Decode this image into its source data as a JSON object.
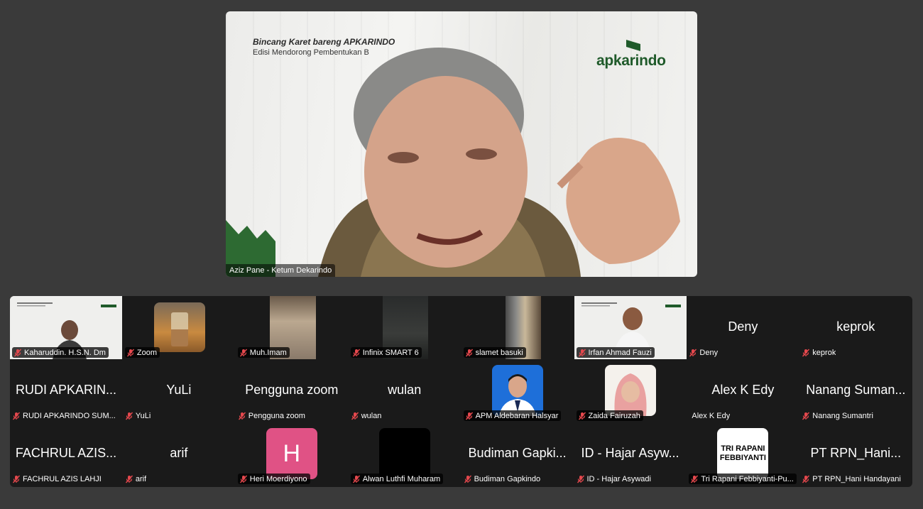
{
  "speaker": {
    "name": "Aziz Pane - Ketum Dekarindo",
    "banner_title": "Bincang Karet bareng APKARINDO",
    "banner_subtitle": "Edisi Mendorong Pembentukan B",
    "logo": "apkarindo"
  },
  "participants": [
    {
      "name": "Kaharuddin. H.S.N. Dm",
      "display": "",
      "video": "banner"
    },
    {
      "name": "Zoom",
      "display": "",
      "video": "drink"
    },
    {
      "name": "Muh.Imam",
      "display": "",
      "video": "wall"
    },
    {
      "name": "Infinix SMART 6",
      "display": "",
      "video": "dark"
    },
    {
      "name": "slamet basuki",
      "display": "",
      "video": "door"
    },
    {
      "name": "Irfan Ahmad Fauzi",
      "display": "",
      "video": "banner2"
    },
    {
      "name": "Deny",
      "display": "Deny",
      "video": "none"
    },
    {
      "name": "keprok",
      "display": "keprok",
      "video": "none"
    },
    {
      "name": "RUDI APKARINDO SUM...",
      "display": "RUDI APKARIN...",
      "video": "none"
    },
    {
      "name": "YuLi",
      "display": "YuLi",
      "video": "none"
    },
    {
      "name": "Pengguna zoom",
      "display": "Pengguna zoom",
      "video": "none"
    },
    {
      "name": "wulan",
      "display": "wulan",
      "video": "none"
    },
    {
      "name": "APM Aldebaran Halsyar",
      "display": "",
      "video": "avatar-man"
    },
    {
      "name": "Zaida Fairuzah",
      "display": "",
      "video": "avatar-woman"
    },
    {
      "name": "Alex K Edy",
      "display": "Alex K Edy",
      "video": "none",
      "unmuted": true
    },
    {
      "name": "Nanang Sumantri",
      "display": "Nanang Suman...",
      "video": "none"
    },
    {
      "name": "FACHRUL AZIS LAHJI",
      "display": "FACHRUL AZIS...",
      "video": "none"
    },
    {
      "name": "arif",
      "display": "arif",
      "video": "none"
    },
    {
      "name": "Heri Moerdiyono",
      "display": "",
      "video": "letter-h",
      "letter": "H"
    },
    {
      "name": "Alwan Luthfi Muharam",
      "display": "",
      "video": "black"
    },
    {
      "name": "Budiman Gapkindo",
      "display": "Budiman Gapki...",
      "video": "none"
    },
    {
      "name": "ID - Hajar Asywadi",
      "display": "ID - Hajar Asyw...",
      "video": "none"
    },
    {
      "name": "Tri Rapani Febbiyanti-Pu...",
      "display": "",
      "video": "text-card",
      "card_text": "TRI RAPANI FEBBIYANTI"
    },
    {
      "name": "PT RPN_Hani Handayani",
      "display": "PT RPN_Hani...",
      "video": "none"
    }
  ],
  "colors": {
    "background": "#3a3a3a",
    "gallery": "#1a1a1a",
    "muted_icon": "#e5484d",
    "brand_green": "#1f5a2a"
  }
}
